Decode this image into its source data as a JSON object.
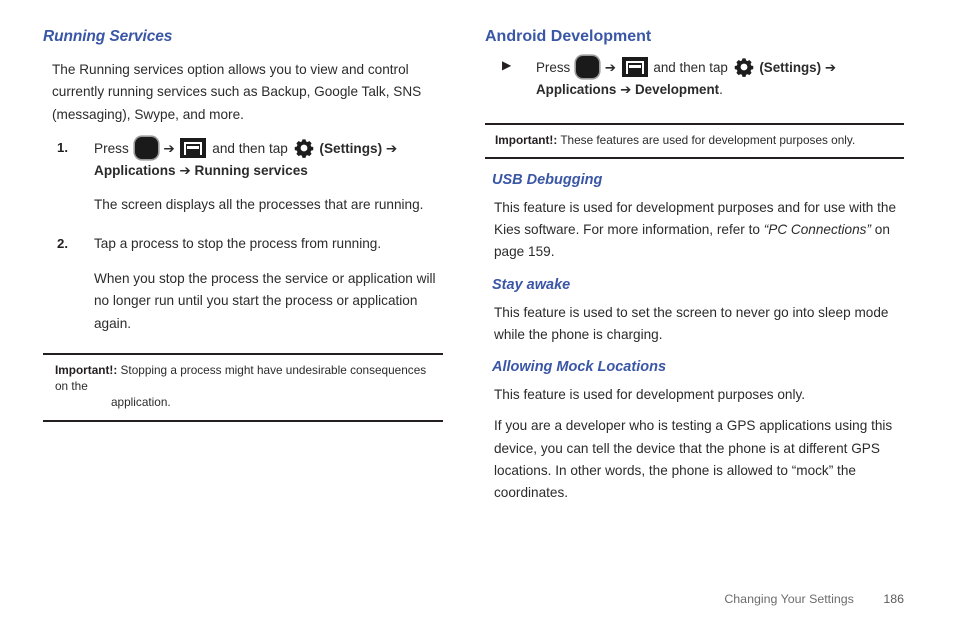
{
  "left_column": {
    "heading": "Running Services",
    "intro": "The Running services option allows you to view and control currently running services such as Backup, Google Talk, SNS (messaging), Swype, and more.",
    "steps": [
      {
        "marker": "1.",
        "lead": "Press",
        "icon_home": "home-icon",
        "arrow1": "➔",
        "icon_menu": "menu-icon",
        "mid": "and then tap",
        "icon_gear": "settings-gear-icon",
        "settings_label": "(Settings)",
        "arrow2": "➔",
        "path_bold": "Applications ➔ Running services",
        "sub": "The screen displays all the processes that are running."
      },
      {
        "marker": "2.",
        "lead": "Tap a process to stop the process from running.",
        "sub": "When you stop the process the service or application will no longer run until you start the process or application again."
      }
    ],
    "note": {
      "label": "Important!:",
      "line1": "Stopping a process might have undesirable consequences on the",
      "line2": "application."
    }
  },
  "right_column": {
    "heading": "Android Development",
    "step": {
      "marker": "▶",
      "lead": "Press",
      "icon_home": "home-icon",
      "arrow1": "➔",
      "icon_menu": "menu-icon",
      "mid": "and then tap",
      "icon_gear": "settings-gear-icon",
      "settings_label": "(Settings)",
      "arrow2": "➔",
      "path_bold": "Applications ➔ Development",
      "path_period": "."
    },
    "note": {
      "label": "Important!:",
      "text": "These features are used for development purposes only."
    },
    "sections": [
      {
        "heading": "USB Debugging",
        "paragraphs": [
          {
            "pre": "This feature is used for development purposes and for use with the Kies software. For more information, refer to ",
            "italic": "“PC Connections”",
            "post": " on page 159."
          }
        ]
      },
      {
        "heading": "Stay awake",
        "paragraphs": [
          {
            "pre": "This feature is used to set the screen to never go into sleep mode while the phone is charging.",
            "italic": "",
            "post": ""
          }
        ]
      },
      {
        "heading": "Allowing Mock Locations",
        "paragraphs": [
          {
            "pre": "This feature is used for development purposes only.",
            "italic": "",
            "post": ""
          },
          {
            "pre": "If you are a developer who is testing a GPS applications using this device, you can tell the device that the phone is at different GPS locations. In other words, the phone is allowed to “mock” the coordinates.",
            "italic": "",
            "post": ""
          }
        ]
      }
    ]
  },
  "footer": {
    "chapter": "Changing Your Settings",
    "page_number": "186"
  },
  "colors": {
    "heading_blue": "#3a56a6",
    "body_text": "#2b2b2b",
    "rule_black": "#231f20",
    "footer_gray": "#6d6d6d"
  }
}
